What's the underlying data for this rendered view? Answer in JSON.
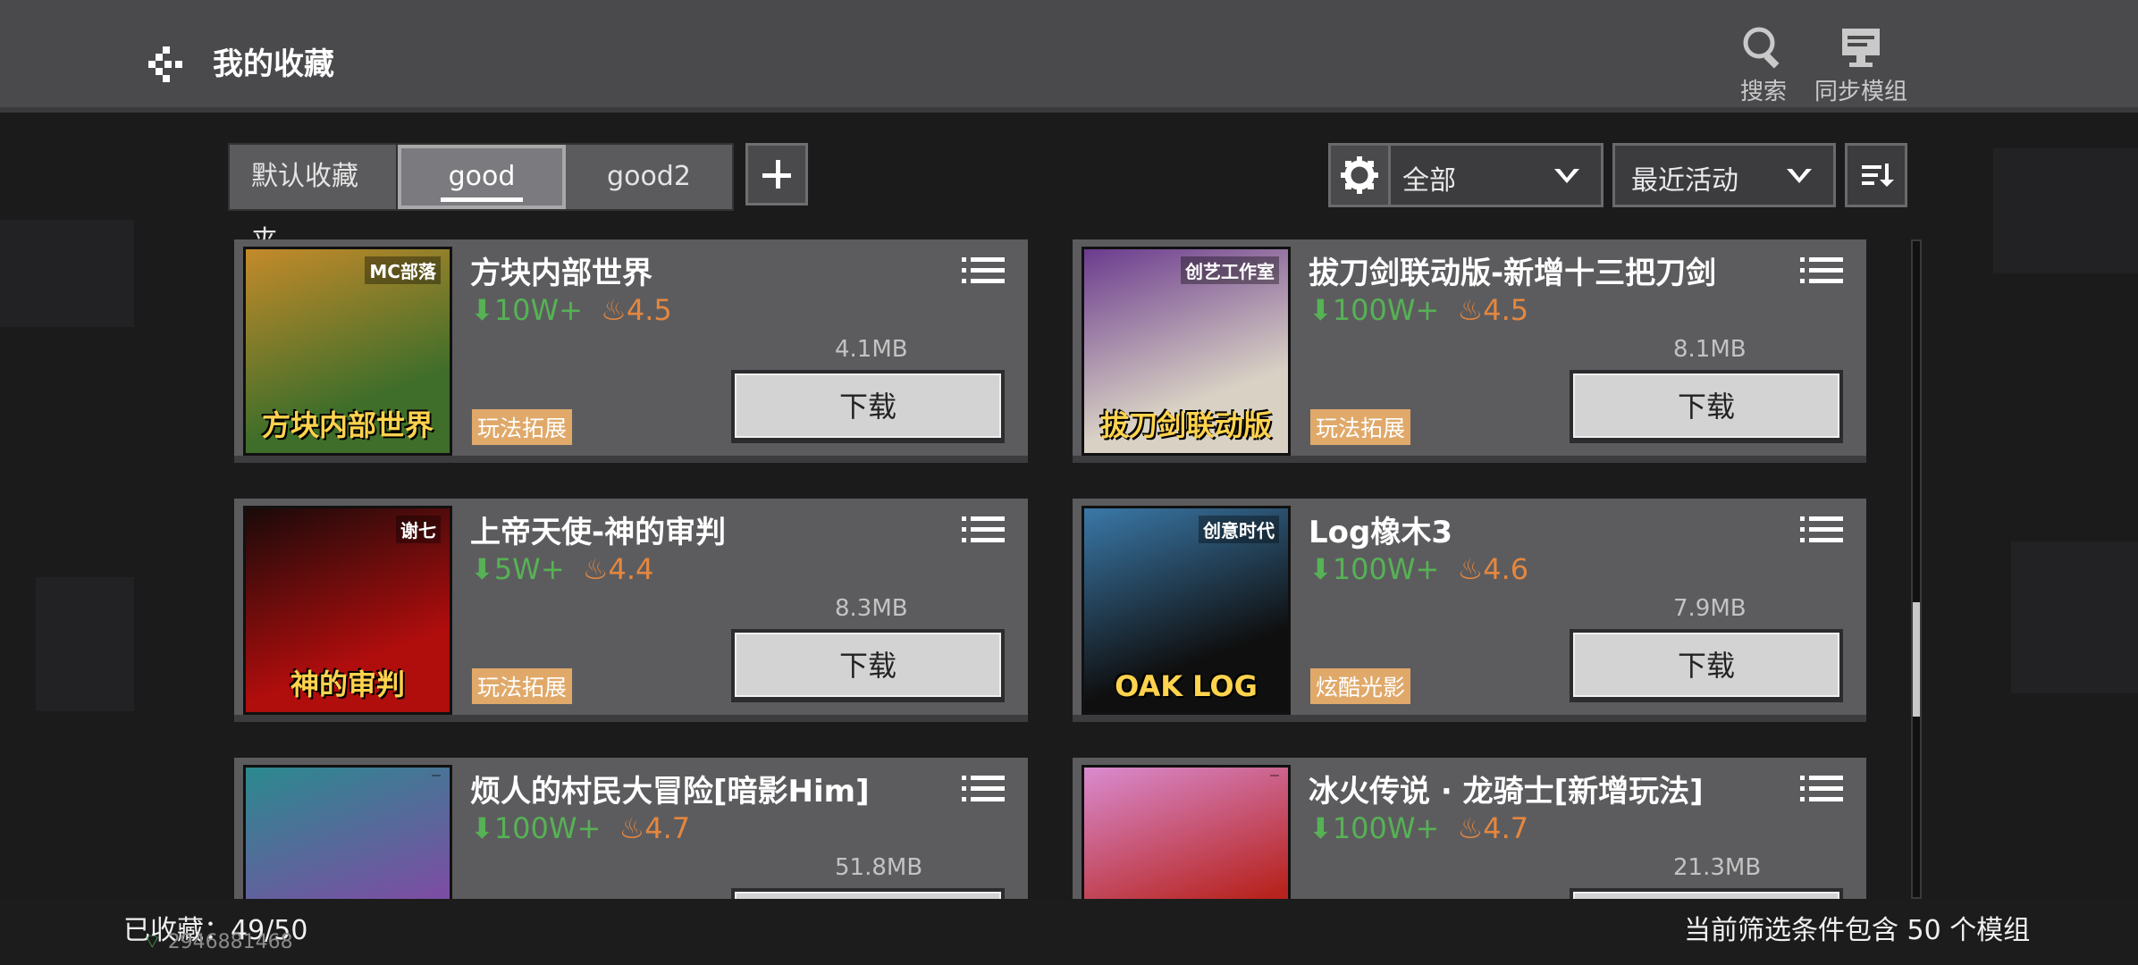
{
  "header": {
    "title": "我的收藏",
    "search_label": "搜索",
    "sync_label": "同步模组"
  },
  "tabs": [
    {
      "label": "默认收藏夹",
      "active": false
    },
    {
      "label": "good",
      "active": true
    },
    {
      "label": "good2",
      "active": false
    }
  ],
  "filters": {
    "category": "全部",
    "sort": "最近活动"
  },
  "download_label": "下载",
  "cards": [
    {
      "name": "方块内部世界",
      "downloads": "10W+",
      "rating": "4.5",
      "size": "4.1MB",
      "tag": "玩法拓展",
      "thumb_text": "方块内部世界",
      "thumb_badge": "MC部落",
      "thumb_colors": [
        "#3f6e2a",
        "#c48a2a"
      ]
    },
    {
      "name": "拔刀剑联动版-新增十三把刀剑",
      "downloads": "100W+",
      "rating": "4.5",
      "size": "8.1MB",
      "tag": "玩法拓展",
      "thumb_text": "拔刀剑联动版",
      "thumb_badge": "创艺工作室",
      "thumb_colors": [
        "#d9d2c4",
        "#6b3b8e"
      ]
    },
    {
      "name": "上帝天使-神的审判",
      "downloads": "5W+",
      "rating": "4.4",
      "size": "8.3MB",
      "tag": "玩法拓展",
      "thumb_text": "神的审判",
      "thumb_badge": "谢七",
      "thumb_colors": [
        "#b00d0d",
        "#1a0a0a"
      ]
    },
    {
      "name": "Log橡木3",
      "downloads": "100W+",
      "rating": "4.6",
      "size": "7.9MB",
      "tag": "炫酷光影",
      "thumb_text": "OAK LOG",
      "thumb_badge": "创意时代",
      "thumb_colors": [
        "#0f0f0f",
        "#3a78a8"
      ]
    },
    {
      "name": "烦人的村民大冒险[暗影Him]",
      "downloads": "100W+",
      "rating": "4.7",
      "size": "51.8MB",
      "tag": "",
      "thumb_text": "",
      "thumb_badge": "",
      "thumb_colors": [
        "#7a4fa3",
        "#2a8a8f"
      ]
    },
    {
      "name": "冰火传说 · 龙骑士[新增玩法]",
      "downloads": "100W+",
      "rating": "4.7",
      "size": "21.3MB",
      "tag": "",
      "thumb_text": "",
      "thumb_badge": "",
      "thumb_colors": [
        "#b7241f",
        "#d98bd0"
      ]
    }
  ],
  "footer": {
    "collected": "已收藏：49/50",
    "filter_summary": "当前筛选条件包含 50 个模组",
    "device_id": "2946881468"
  }
}
